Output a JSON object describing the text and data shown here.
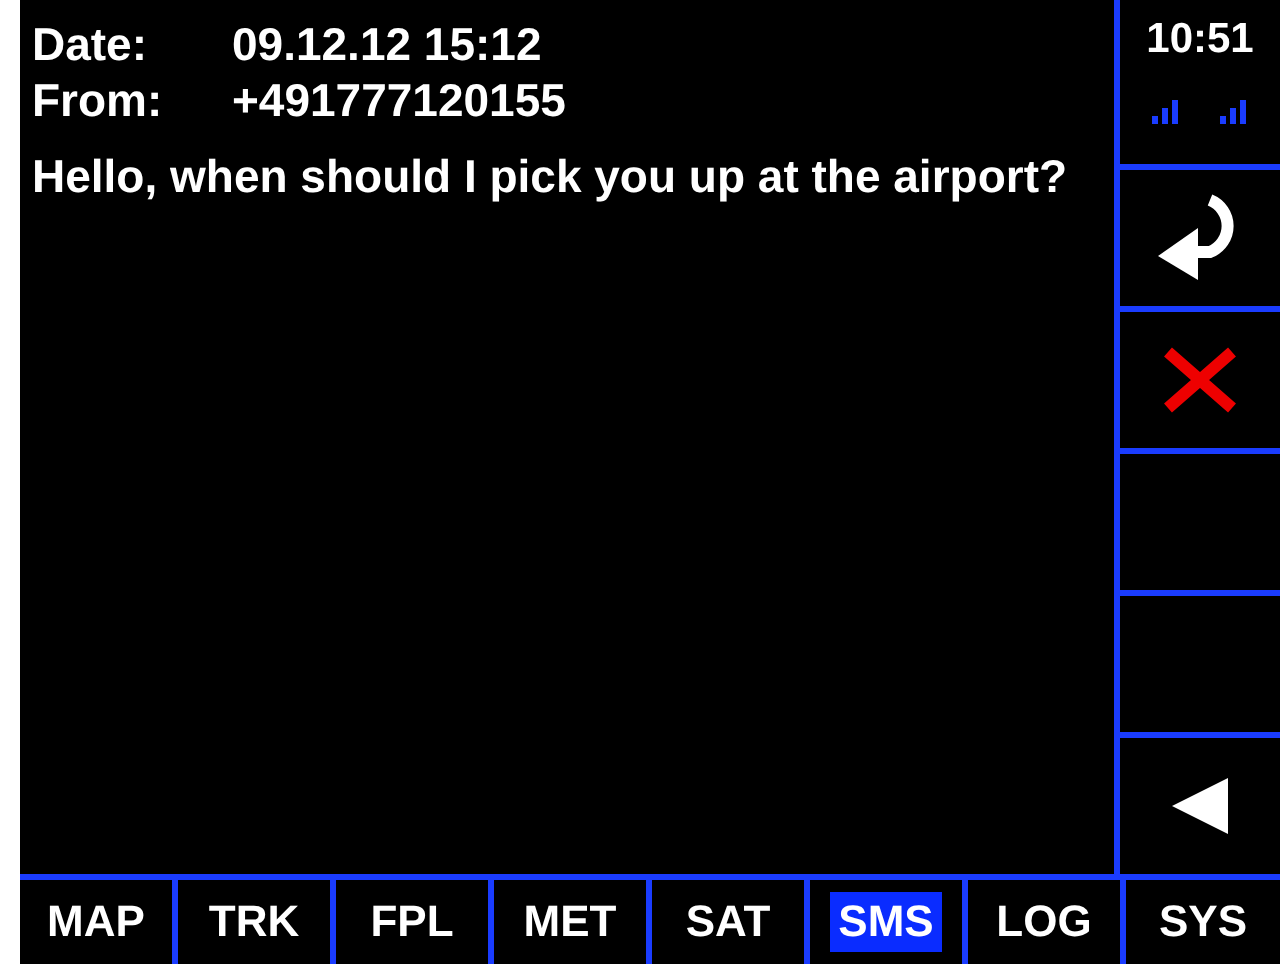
{
  "message": {
    "date_label": "Date:",
    "date": "09.12.12 15:12",
    "from_label": "From:",
    "from": "+491777120155",
    "body": "Hello, when should I pick you up at the airport?"
  },
  "status": {
    "time": "10:51"
  },
  "side_buttons": [
    {
      "kind": "reply"
    },
    {
      "kind": "delete"
    },
    {
      "kind": "blank"
    },
    {
      "kind": "blank"
    },
    {
      "kind": "back"
    }
  ],
  "tabs": [
    {
      "label": "MAP",
      "selected": false
    },
    {
      "label": "TRK",
      "selected": false
    },
    {
      "label": "FPL",
      "selected": false
    },
    {
      "label": "MET",
      "selected": false
    },
    {
      "label": "SAT",
      "selected": false
    },
    {
      "label": "SMS",
      "selected": true
    },
    {
      "label": "LOG",
      "selected": false
    },
    {
      "label": "SYS",
      "selected": false
    }
  ]
}
